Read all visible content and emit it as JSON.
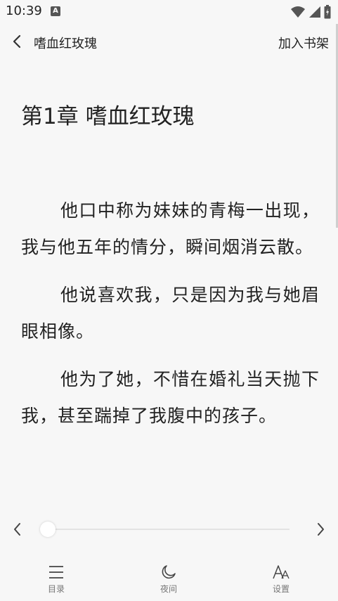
{
  "status_bar": {
    "time": "10:39",
    "notification_icon": "a-icon",
    "icons": [
      "wifi-icon",
      "signal-icon",
      "battery-icon"
    ]
  },
  "header": {
    "title": "嗜血红玫瑰",
    "add_to_shelf": "加入书架",
    "back_icon": "chevron-left-icon"
  },
  "chapter": {
    "title": "第1章 嗜血红玫瑰",
    "paragraphs": [
      "他口中称为妹妹的青梅一出现，我与他五年的情分，瞬间烟消云散。",
      "他说喜欢我，只是因为我与她眉眼相像。",
      "他为了她，不惜在婚礼当天抛下我，甚至踹掉了我腹中的孩子。"
    ]
  },
  "progress": {
    "value": 0,
    "prev_icon": "chevron-left-icon",
    "next_icon": "chevron-right-icon"
  },
  "bottom_nav": {
    "items": [
      {
        "label": "目录",
        "icon": "menu-icon"
      },
      {
        "label": "夜间",
        "icon": "moon-icon"
      },
      {
        "label": "设置",
        "icon": "font-size-icon"
      }
    ]
  },
  "colors": {
    "background": "#f7f7f7",
    "text": "#222222",
    "muted": "#777777"
  }
}
